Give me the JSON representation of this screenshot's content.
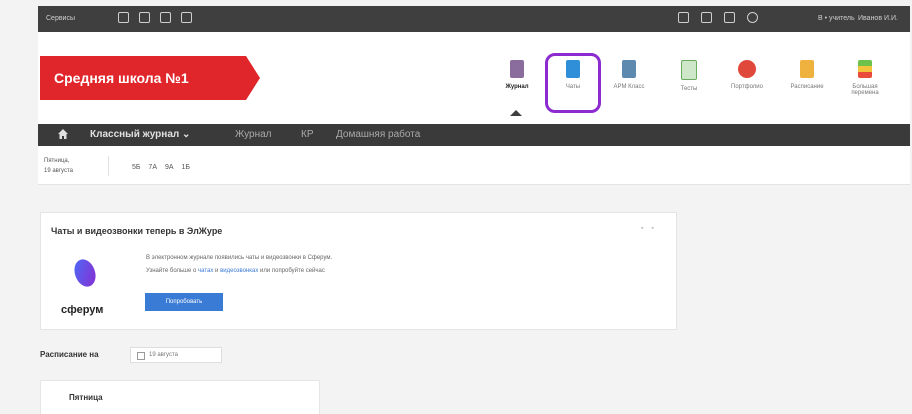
{
  "topbar": {
    "services_label": "Сервисы",
    "user_label": "В • учитель",
    "user_name": "Иванов И.И."
  },
  "school": {
    "title": "Средняя школа №1"
  },
  "modules": [
    {
      "label": "Журнал",
      "icon": "journal-icon"
    },
    {
      "label": "Чаты",
      "icon": "chats-icon"
    },
    {
      "label": "АРМ Класс",
      "icon": "class-icon"
    },
    {
      "label": "Тесты",
      "icon": "tests-icon"
    },
    {
      "label": "Портфолио",
      "icon": "portfolio-icon"
    },
    {
      "label": "Расписание",
      "icon": "schedule-icon"
    },
    {
      "label": "Большая перемена",
      "icon": "break-icon"
    }
  ],
  "nav": {
    "main": "Классный журнал ⌄",
    "items": [
      "Журнал",
      "КР",
      "Домашняя работа"
    ]
  },
  "day": {
    "line1": "Пятница,",
    "line2": "19 августа",
    "classes": "5Б 7А 9А 1Б"
  },
  "promo": {
    "title": "Чаты и видеозвонки теперь в ЭлЖуре",
    "text1": "В электронном журнале появились чаты и видеозвонки в Сферум.",
    "text2_a": "Узнайте больше о ",
    "text2_link1": "чатах",
    "text2_b": " и ",
    "text2_link2": "видеозвонках",
    "text2_c": " или попробуйте сейчас",
    "button": "Попробовать",
    "brand": "сферум"
  },
  "schedule": {
    "label": "Расписание на",
    "date": "19 августа",
    "day": "Пятница"
  },
  "colors": {
    "brand_red": "#e0262b",
    "highlight": "#8b2bd0",
    "primary": "#3a7bd5"
  }
}
